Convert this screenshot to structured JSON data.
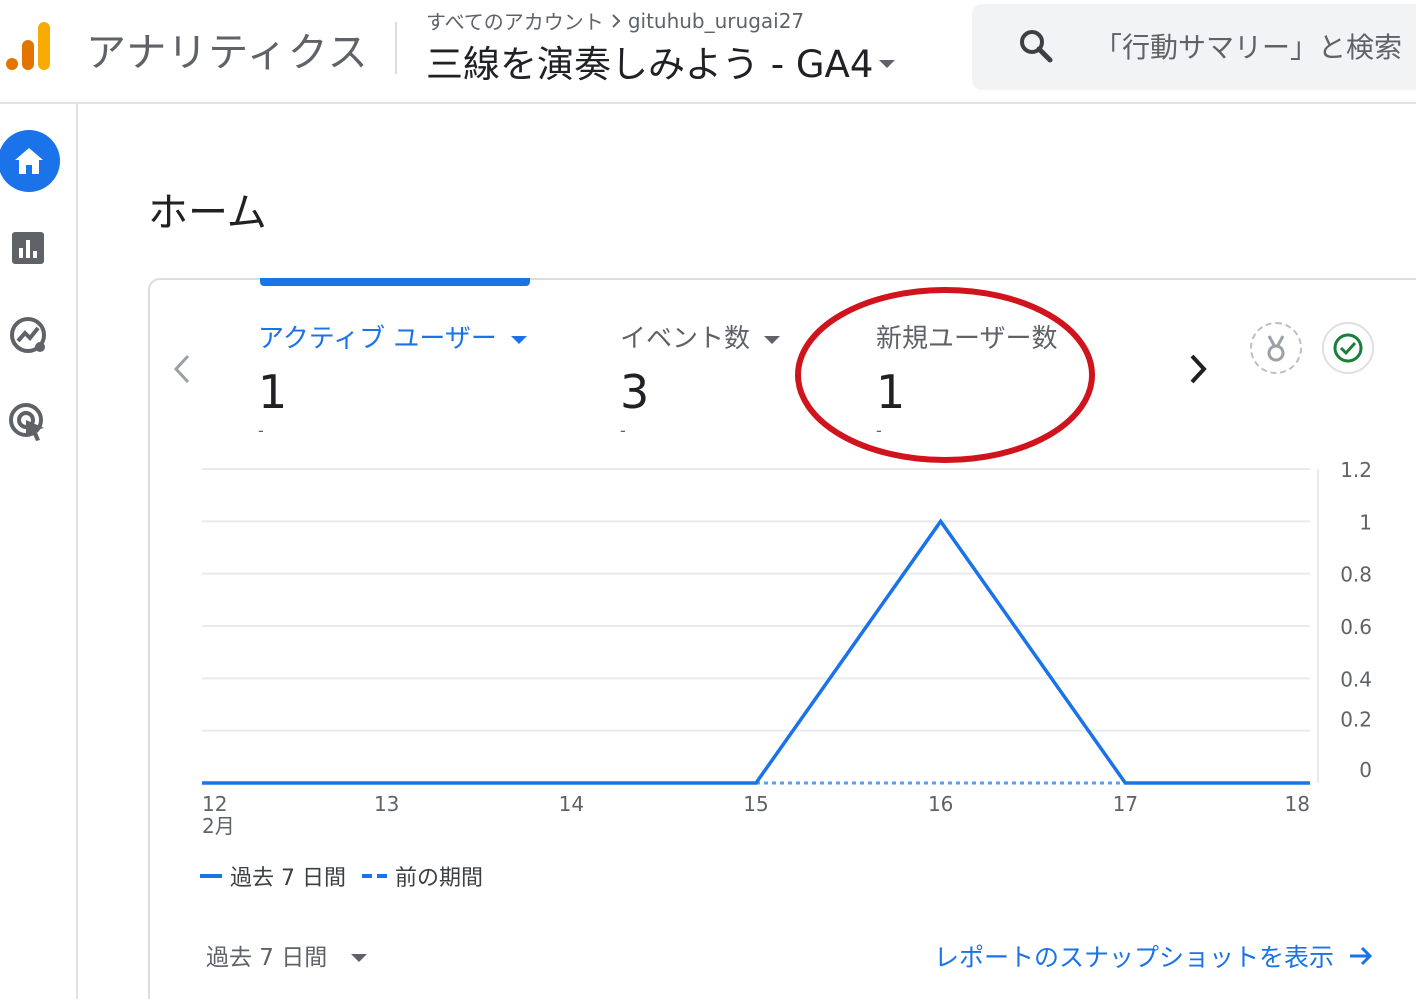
{
  "header": {
    "app_name": "アナリティクス",
    "breadcrumb_root": "すべてのアカウント",
    "breadcrumb_account": "gituhub_urugai27",
    "property_name": "三線を演奏しみよう - GA4",
    "search_placeholder": "「行動サマリー」と検索"
  },
  "nav": {
    "items": [
      {
        "icon": "home-icon",
        "active": true
      },
      {
        "icon": "reports-icon",
        "active": false
      },
      {
        "icon": "explore-icon",
        "active": false
      },
      {
        "icon": "advertising-icon",
        "active": false
      }
    ]
  },
  "page": {
    "title": "ホーム"
  },
  "metrics": [
    {
      "label": "アクティブ ユーザー",
      "value": "1",
      "sub": "-",
      "selected": true
    },
    {
      "label": "イベント数",
      "value": "3",
      "sub": "-",
      "selected": false
    },
    {
      "label": "新規ユーザー数",
      "value": "1",
      "sub": "-",
      "selected": false
    }
  ],
  "chart_data": {
    "type": "line",
    "x": [
      "12",
      "13",
      "14",
      "15",
      "16",
      "17",
      "18"
    ],
    "x_month_label": "2月",
    "series": [
      {
        "name": "過去 7 日間",
        "values": [
          0,
          0,
          0,
          0,
          1,
          0,
          0
        ],
        "style": "solid"
      },
      {
        "name": "前の期間",
        "values": [
          null,
          null,
          null,
          0,
          0,
          0,
          null
        ],
        "style": "dashed"
      }
    ],
    "ylim": [
      0,
      1.2
    ],
    "yticks": [
      "1.2",
      "1",
      "0.8",
      "0.6",
      "0.4",
      "0.2",
      "0"
    ],
    "grid": true,
    "color": "#1a73e8"
  },
  "legend": {
    "current": "過去 7 日間",
    "previous": "前の期間"
  },
  "footer": {
    "date_range": "過去 7 日間",
    "snapshot_link": "レポートのスナップショットを表示"
  },
  "colors": {
    "accent": "#1a73e8",
    "highlight": "#d0131c"
  }
}
